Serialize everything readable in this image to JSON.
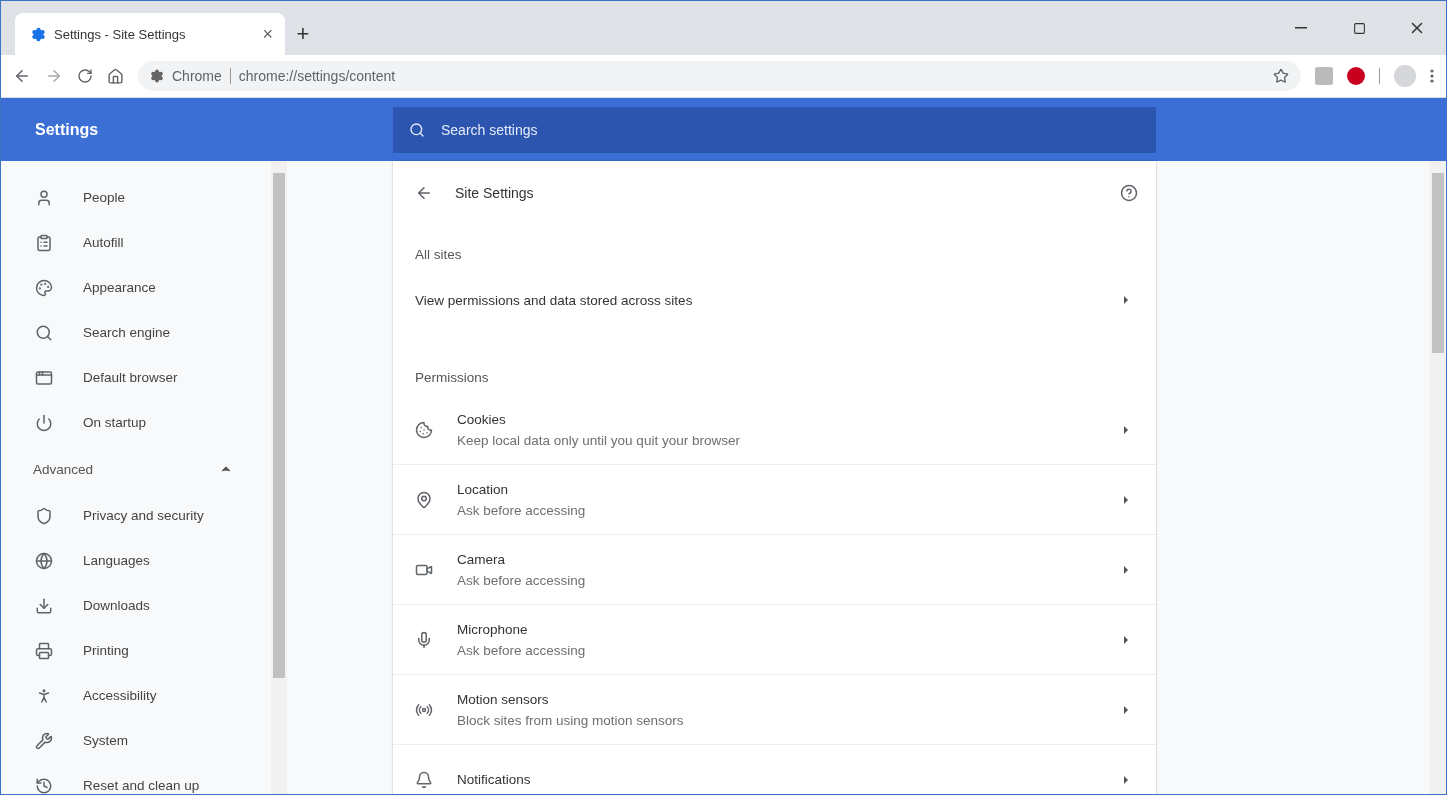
{
  "tab": {
    "title": "Settings - Site Settings",
    "close": "×",
    "new_tab": "+"
  },
  "address": {
    "site": "Chrome",
    "url": "chrome://settings/content"
  },
  "header": {
    "title": "Settings",
    "search": {
      "placeholder": "Search settings"
    }
  },
  "sidebar": {
    "items": [
      {
        "label": "People"
      },
      {
        "label": "Autofill"
      },
      {
        "label": "Appearance"
      },
      {
        "label": "Search engine"
      },
      {
        "label": "Default browser"
      },
      {
        "label": "On startup"
      }
    ],
    "advanced": {
      "label": "Advanced",
      "expanded": true,
      "items": [
        {
          "label": "Privacy and security"
        },
        {
          "label": "Languages"
        },
        {
          "label": "Downloads"
        },
        {
          "label": "Printing"
        },
        {
          "label": "Accessibility"
        },
        {
          "label": "System"
        },
        {
          "label": "Reset and clean up"
        }
      ]
    }
  },
  "page": {
    "title": "Site Settings",
    "all_sites": {
      "heading": "All sites",
      "link": "View permissions and data stored across sites"
    },
    "permissions": {
      "heading": "Permissions",
      "items": [
        {
          "title": "Cookies",
          "description": "Keep local data only until you quit your browser"
        },
        {
          "title": "Location",
          "description": "Ask before accessing"
        },
        {
          "title": "Camera",
          "description": "Ask before accessing"
        },
        {
          "title": "Microphone",
          "description": "Ask before accessing"
        },
        {
          "title": "Motion sensors",
          "description": "Block sites from using motion sensors"
        },
        {
          "title": "Notifications"
        }
      ]
    }
  }
}
